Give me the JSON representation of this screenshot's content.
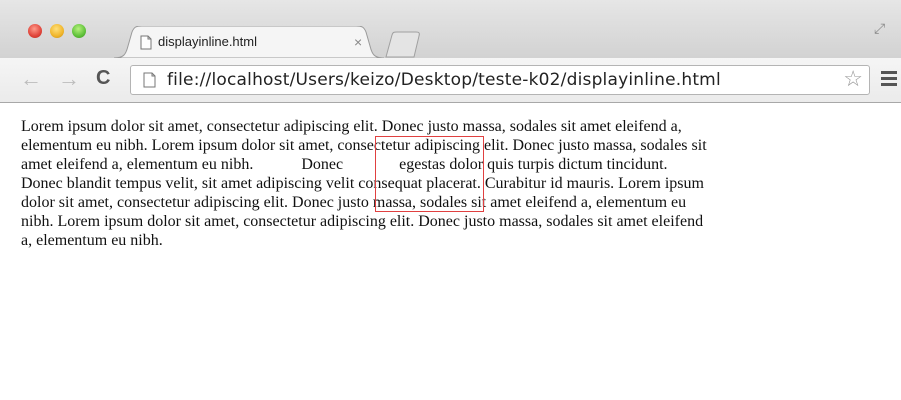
{
  "tab": {
    "title": "displayinline.html",
    "close": "×"
  },
  "toolbar": {
    "back": "←",
    "forward": "→",
    "reload": "C",
    "url": "file://localhost/Users/keizo/Desktop/teste-k02/displayinline.html",
    "star": "☆"
  },
  "content": {
    "lines": [
      "Lorem ipsum dolor sit amet, consectetur adipiscing elit. Donec justo massa, sodales sit amet eleifend a,",
      "elementum eu nibh. Lorem ipsum dolor sit amet, consectetur adipiscing elit. Donec justo massa, sodales sit",
      "amet eleifend a, elementum eu nibh.            Donec              egestas dolor quis turpis dictum tincidunt.",
      "Donec blandit tempus velit, sit amet adipiscing velit consequat placerat. Curabitur id mauris. Lorem ipsum",
      "dolor sit amet, consectetur adipiscing elit. Donec justo massa, sodales sit amet eleifend a, elementum eu",
      "nibh. Lorem ipsum dolor sit amet, consectetur adipiscing elit. Donec justo massa, sodales sit amet eleifend",
      "a, elementum eu nibh."
    ]
  },
  "colors": {
    "inline_box_border": "#e04040"
  }
}
